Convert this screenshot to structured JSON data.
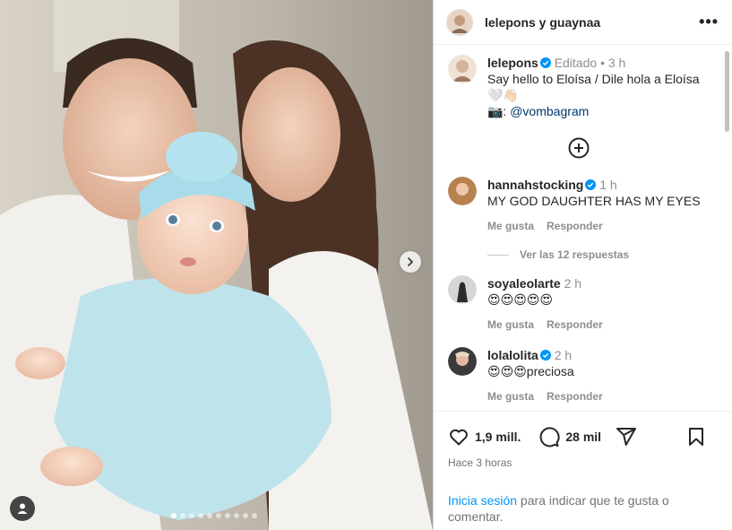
{
  "header": {
    "title": "lelepons y guaynaa",
    "more": "•••"
  },
  "caption": {
    "username": "lelepons",
    "edited": "Editado",
    "dot": "•",
    "time": "3 h",
    "line1": "Say hello to Eloísa / Dile hola a Eloísa",
    "line2": "🤍👋🏻",
    "camera": "📷: ",
    "mention": "@vombagram"
  },
  "comments": [
    {
      "username": "hannahstocking",
      "time": "1 h",
      "text": "MY GOD DAUGHTER HAS MY EYES",
      "like": "Me gusta",
      "reply": "Responder",
      "replies": "Ver las 12 respuestas"
    },
    {
      "username": "soyaleolarte",
      "time": "2 h",
      "text": "😍😍😍😍😍",
      "like": "Me gusta",
      "reply": "Responder"
    },
    {
      "username": "lolalolita",
      "time": "2 h",
      "text": "😍😍😍preciosa",
      "like": "Me gusta",
      "reply": "Responder"
    }
  ],
  "footer": {
    "likes": "1,9 mill.",
    "comments_count": "28 mil",
    "timestamp": "Hace 3 horas",
    "login_cta": "Inicia sesión",
    "login_rest": " para indicar que te gusta o comentar."
  },
  "carousel": {
    "dot_count": 10,
    "active_index": 0
  },
  "colors": {
    "accent": "#0095f6",
    "verified": "#0095f6",
    "muted": "#8e8e8e"
  }
}
